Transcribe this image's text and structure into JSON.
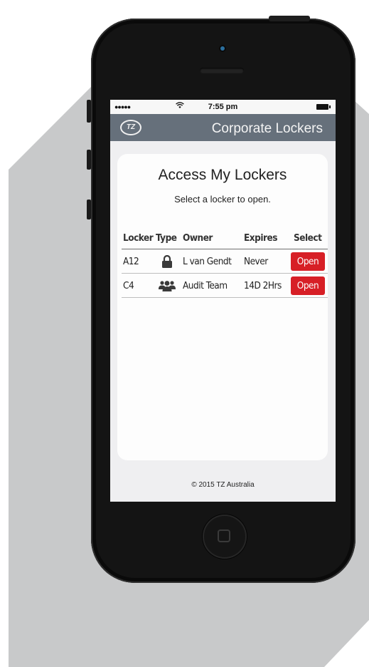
{
  "status_bar": {
    "signal": "●●●●●",
    "time": "7:55 pm",
    "wifi_icon": "wifi-icon",
    "battery_icon": "battery-icon"
  },
  "app_bar": {
    "logo_text": "TZ",
    "title": "Corporate Lockers"
  },
  "card": {
    "title": "Access My Lockers",
    "subtitle": "Select a locker to open."
  },
  "table": {
    "headers": [
      "Locker",
      "Type",
      "Owner",
      "Expires",
      "Select"
    ],
    "rows": [
      {
        "locker": "A12",
        "type_icon": "lock-icon",
        "owner": "L van Gendt",
        "expires": "Never",
        "action": "Open"
      },
      {
        "locker": "C4",
        "type_icon": "group-icon",
        "owner": "Audit Team",
        "expires": "14D 2Hrs",
        "action": "Open"
      }
    ]
  },
  "footer": "© 2015 TZ Australia",
  "colors": {
    "app_bar": "#66707b",
    "open_button": "#d71f26",
    "screen_bg": "#efeff1",
    "phone_body": "#141414"
  }
}
